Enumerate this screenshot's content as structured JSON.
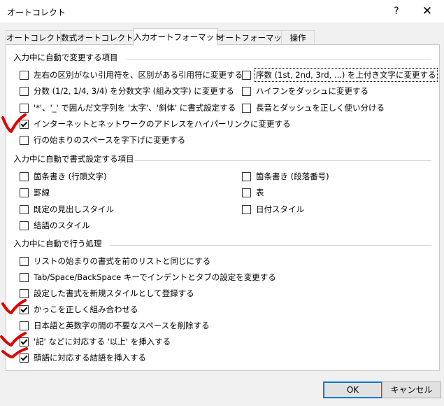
{
  "window": {
    "title": "オートコレクト",
    "help": "?",
    "close": "✕"
  },
  "tabs": [
    {
      "label": "オートコレクト"
    },
    {
      "label": "数式オートコレクト"
    },
    {
      "label": "入力オートフォーマット"
    },
    {
      "label": "オートフォーマット"
    },
    {
      "label": "操作"
    }
  ],
  "active_tab": "入力オートフォーマット",
  "sections": {
    "replace": {
      "title": "入力中に自動で変更する項目",
      "items": [
        {
          "label": "左右の区別がない引用符を、区別がある引用符に変更する",
          "checked": false
        },
        {
          "label": "序数 (1st, 2nd, 3rd, ...) を上付き文字に変更する",
          "checked": false
        },
        {
          "label": "分数 (1/2, 1/4, 3/4) を分数文字 (組み文字) に変更する",
          "checked": false
        },
        {
          "label": "ハイフンをダッシュに変更する",
          "checked": false
        },
        {
          "label": "'*'、'_' で囲んだ文字列を '太字'、'斜体' に書式設定する",
          "checked": false
        },
        {
          "label": "長音とダッシュを正しく使い分ける",
          "checked": false
        },
        {
          "label": "インターネットとネットワークのアドレスをハイパーリンクに変更する",
          "checked": true
        },
        {
          "label": "行の始まりのスペースを字下げに変更する",
          "checked": false
        }
      ]
    },
    "format": {
      "title": "入力中に自動で書式設定する項目",
      "items": [
        {
          "label": "箇条書き (行頭文字)",
          "checked": false
        },
        {
          "label": "箇条書き (段落番号)",
          "checked": false
        },
        {
          "label": "罫線",
          "checked": false
        },
        {
          "label": "表",
          "checked": false
        },
        {
          "label": "既定の見出しスタイル",
          "checked": false
        },
        {
          "label": "日付スタイル",
          "checked": false
        },
        {
          "label": "結語のスタイル",
          "checked": false
        }
      ]
    },
    "process": {
      "title": "入力中に自動で行う処理",
      "items": [
        {
          "label": "リストの始まりの書式を前のリストと同じにする",
          "checked": false
        },
        {
          "label": "Tab/Space/BackSpace キーでインデントとタブの設定を変更する",
          "checked": false
        },
        {
          "label": "設定した書式を新規スタイルとして登録する",
          "checked": false
        },
        {
          "label": "かっこを正しく組み合わせる",
          "checked": true
        },
        {
          "label": "日本語と英数字の間の不要なスペースを削除する",
          "checked": false
        },
        {
          "label": "'記' などに対応する '以上' を挿入する",
          "checked": true
        },
        {
          "label": "頭語に対応する結語を挿入する",
          "checked": true
        }
      ]
    }
  },
  "buttons": {
    "ok": "OK",
    "cancel": "キャンセル"
  },
  "colors": {
    "accent": "#0078d7",
    "annotation": "#e00000"
  }
}
